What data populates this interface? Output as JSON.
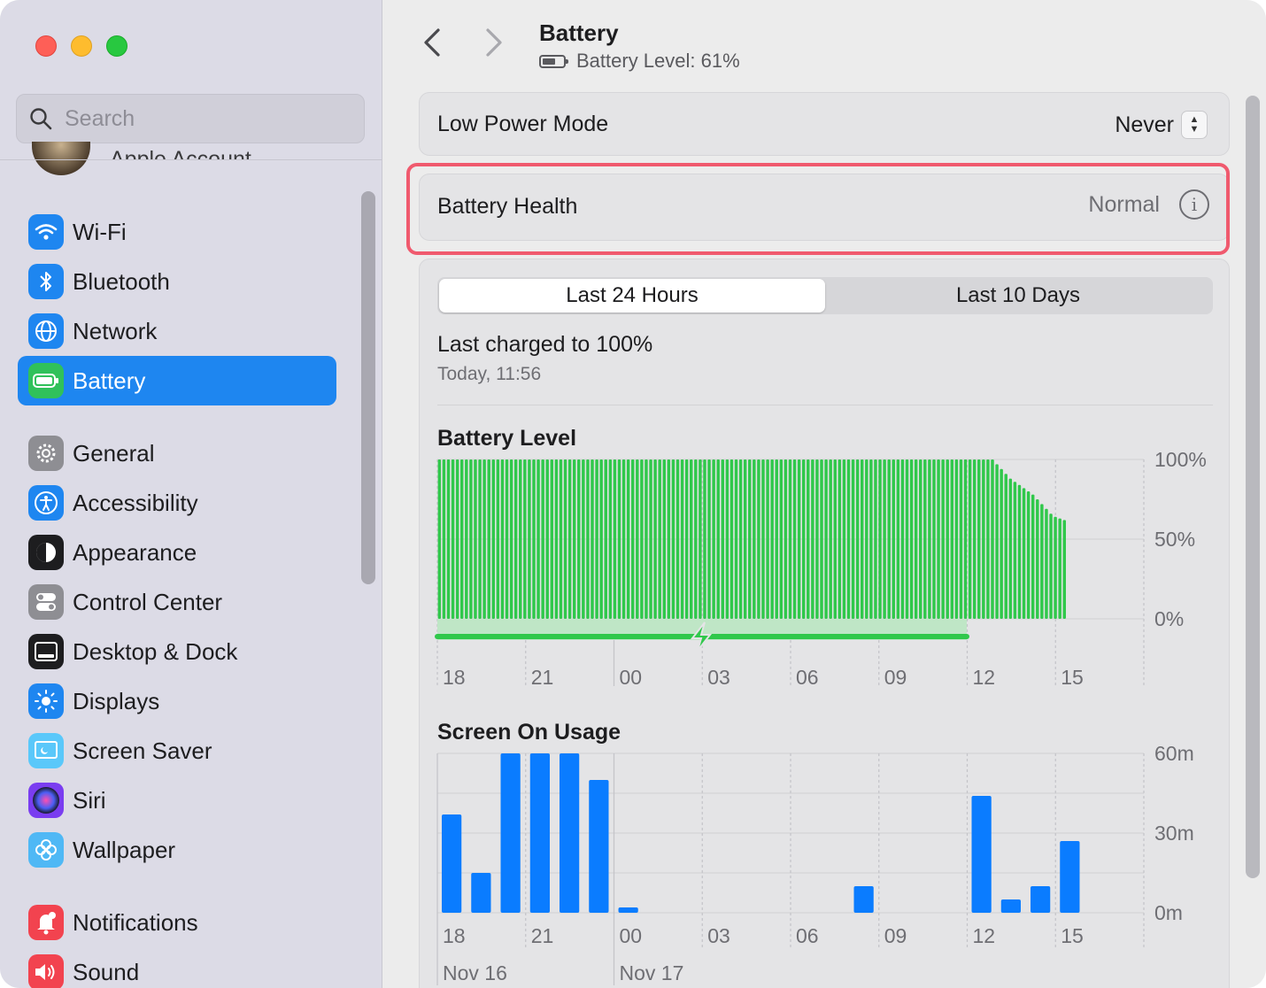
{
  "window": {
    "title": "Battery",
    "subtitle": "Battery Level: 61%"
  },
  "search": {
    "placeholder": "Search"
  },
  "account": {
    "label": "Apple Account"
  },
  "sidebar": {
    "items": [
      {
        "label": "Wi-Fi",
        "icon": "wifi-icon",
        "color": "#1e86f0"
      },
      {
        "label": "Bluetooth",
        "icon": "bluetooth-icon",
        "color": "#1e86f0"
      },
      {
        "label": "Network",
        "icon": "globe-icon",
        "color": "#1e86f0"
      },
      {
        "label": "Battery",
        "icon": "battery-icon",
        "color": "#30c15a",
        "active": true
      },
      {
        "label": "General",
        "icon": "gear-icon",
        "color": "#8e8e93"
      },
      {
        "label": "Accessibility",
        "icon": "accessibility-icon",
        "color": "#1e86f0"
      },
      {
        "label": "Appearance",
        "icon": "appearance-icon",
        "color": "#1d1d1f"
      },
      {
        "label": "Control Center",
        "icon": "toggles-icon",
        "color": "#8e8e93"
      },
      {
        "label": "Desktop & Dock",
        "icon": "dock-icon",
        "color": "#1d1d1f"
      },
      {
        "label": "Displays",
        "icon": "sun-icon",
        "color": "#1e86f0"
      },
      {
        "label": "Screen Saver",
        "icon": "screen-saver-icon",
        "color": "#5ac8fa"
      },
      {
        "label": "Siri",
        "icon": "siri-icon",
        "color": "#7a3df0"
      },
      {
        "label": "Wallpaper",
        "icon": "flower-icon",
        "color": "#4fb8f5"
      },
      {
        "label": "Notifications",
        "icon": "bell-icon",
        "color": "#f2434f"
      },
      {
        "label": "Sound",
        "icon": "speaker-icon",
        "color": "#f2434f"
      }
    ]
  },
  "low_power": {
    "label": "Low Power Mode",
    "value": "Never"
  },
  "battery_health": {
    "label": "Battery Health",
    "value": "Normal"
  },
  "tabs": {
    "selected": "Last 24 Hours",
    "other": "Last 10 Days"
  },
  "last_charged": {
    "title": "Last charged to 100%",
    "time": "Today, 11:56"
  },
  "colors": {
    "battery_bar": "#30c84b",
    "charging": "#30c84b",
    "usage_bar": "#0a7cff",
    "highlight": "#f05a6e"
  },
  "chart_data": [
    {
      "type": "bar",
      "title": "Battery Level",
      "y_ticks": [
        "100%",
        "50%",
        "0%"
      ],
      "x_ticks": [
        "18",
        "21",
        "00",
        "03",
        "06",
        "09",
        "12",
        "15"
      ],
      "ylim": [
        0,
        100
      ],
      "values": [
        100,
        100,
        100,
        100,
        100,
        100,
        100,
        100,
        100,
        100,
        100,
        100,
        100,
        100,
        100,
        100,
        100,
        100,
        100,
        100,
        100,
        100,
        100,
        100,
        100,
        100,
        100,
        100,
        100,
        100,
        100,
        100,
        100,
        100,
        100,
        100,
        100,
        100,
        100,
        100,
        100,
        100,
        100,
        100,
        100,
        100,
        100,
        100,
        100,
        100,
        100,
        100,
        100,
        100,
        100,
        100,
        100,
        100,
        100,
        100,
        100,
        100,
        100,
        100,
        100,
        100,
        100,
        100,
        100,
        100,
        100,
        100,
        100,
        100,
        100,
        100,
        100,
        100,
        100,
        100,
        100,
        100,
        100,
        100,
        100,
        100,
        100,
        100,
        100,
        100,
        100,
        100,
        100,
        100,
        100,
        100,
        100,
        100,
        100,
        100,
        100,
        100,
        100,
        100,
        100,
        100,
        100,
        100,
        100,
        100,
        100,
        100,
        100,
        100,
        100,
        100,
        100,
        100,
        100,
        100,
        100,
        100,
        100,
        100,
        97,
        94,
        91,
        88,
        86,
        84,
        82,
        80,
        78,
        75,
        72,
        69,
        66,
        64,
        63,
        62
      ],
      "charging_until": "11:56"
    },
    {
      "type": "bar",
      "title": "Screen On Usage",
      "y_ticks": [
        "60m",
        "30m",
        "0m"
      ],
      "x_ticks": [
        "18",
        "21",
        "00",
        "03",
        "06",
        "09",
        "12",
        "15"
      ],
      "date_labels": [
        {
          "at": "18",
          "label": "Nov 16"
        },
        {
          "at": "00",
          "label": "Nov 17"
        }
      ],
      "ylim": [
        0,
        60
      ],
      "values": [
        37,
        15,
        60,
        60,
        60,
        50,
        2,
        0,
        0,
        0,
        0,
        0,
        0,
        0,
        10,
        0,
        0,
        0,
        44,
        5,
        10,
        27,
        0,
        0
      ]
    }
  ]
}
